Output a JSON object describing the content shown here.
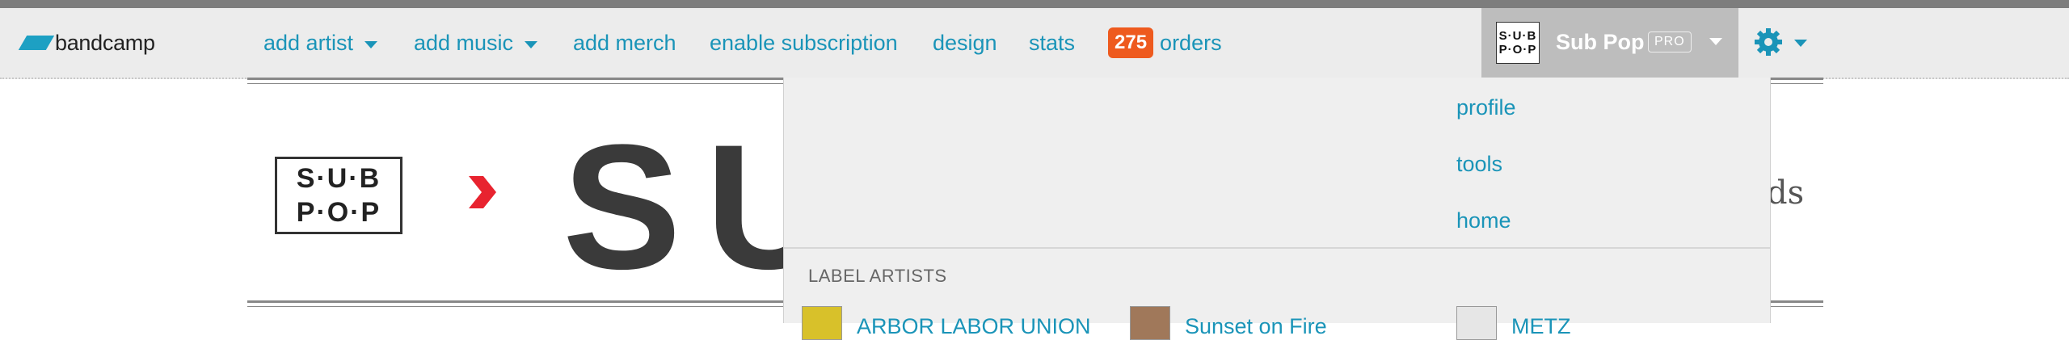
{
  "app": {
    "logo_text": "bandcamp"
  },
  "nav": {
    "add_artist": "add artist",
    "add_music": "add music",
    "add_merch": "add merch",
    "enable_subscription": "enable subscription",
    "design": "design",
    "stats": "stats",
    "orders_count": "275",
    "orders": "orders"
  },
  "account": {
    "name": "Sub Pop",
    "tier": "PRO",
    "avatar_lines": [
      "S·U·B",
      "P·O·P"
    ]
  },
  "banner": {
    "logo_lines": [
      "S·U·B",
      "P·O·P"
    ],
    "big_text": "SU",
    "tail_text": "ds"
  },
  "dropdown": {
    "links": [
      "profile",
      "tools",
      "home"
    ],
    "section_title": "LABEL ARTISTS",
    "artists": [
      {
        "name": "ARBOR LABOR UNION"
      },
      {
        "name": "Sunset on Fire"
      },
      {
        "name": "METZ"
      }
    ]
  },
  "colors": {
    "accent": "#1a94b8",
    "badge": "#ee5a1e",
    "account_bg": "#bdbdbd",
    "menubar_bg": "#ececec"
  }
}
